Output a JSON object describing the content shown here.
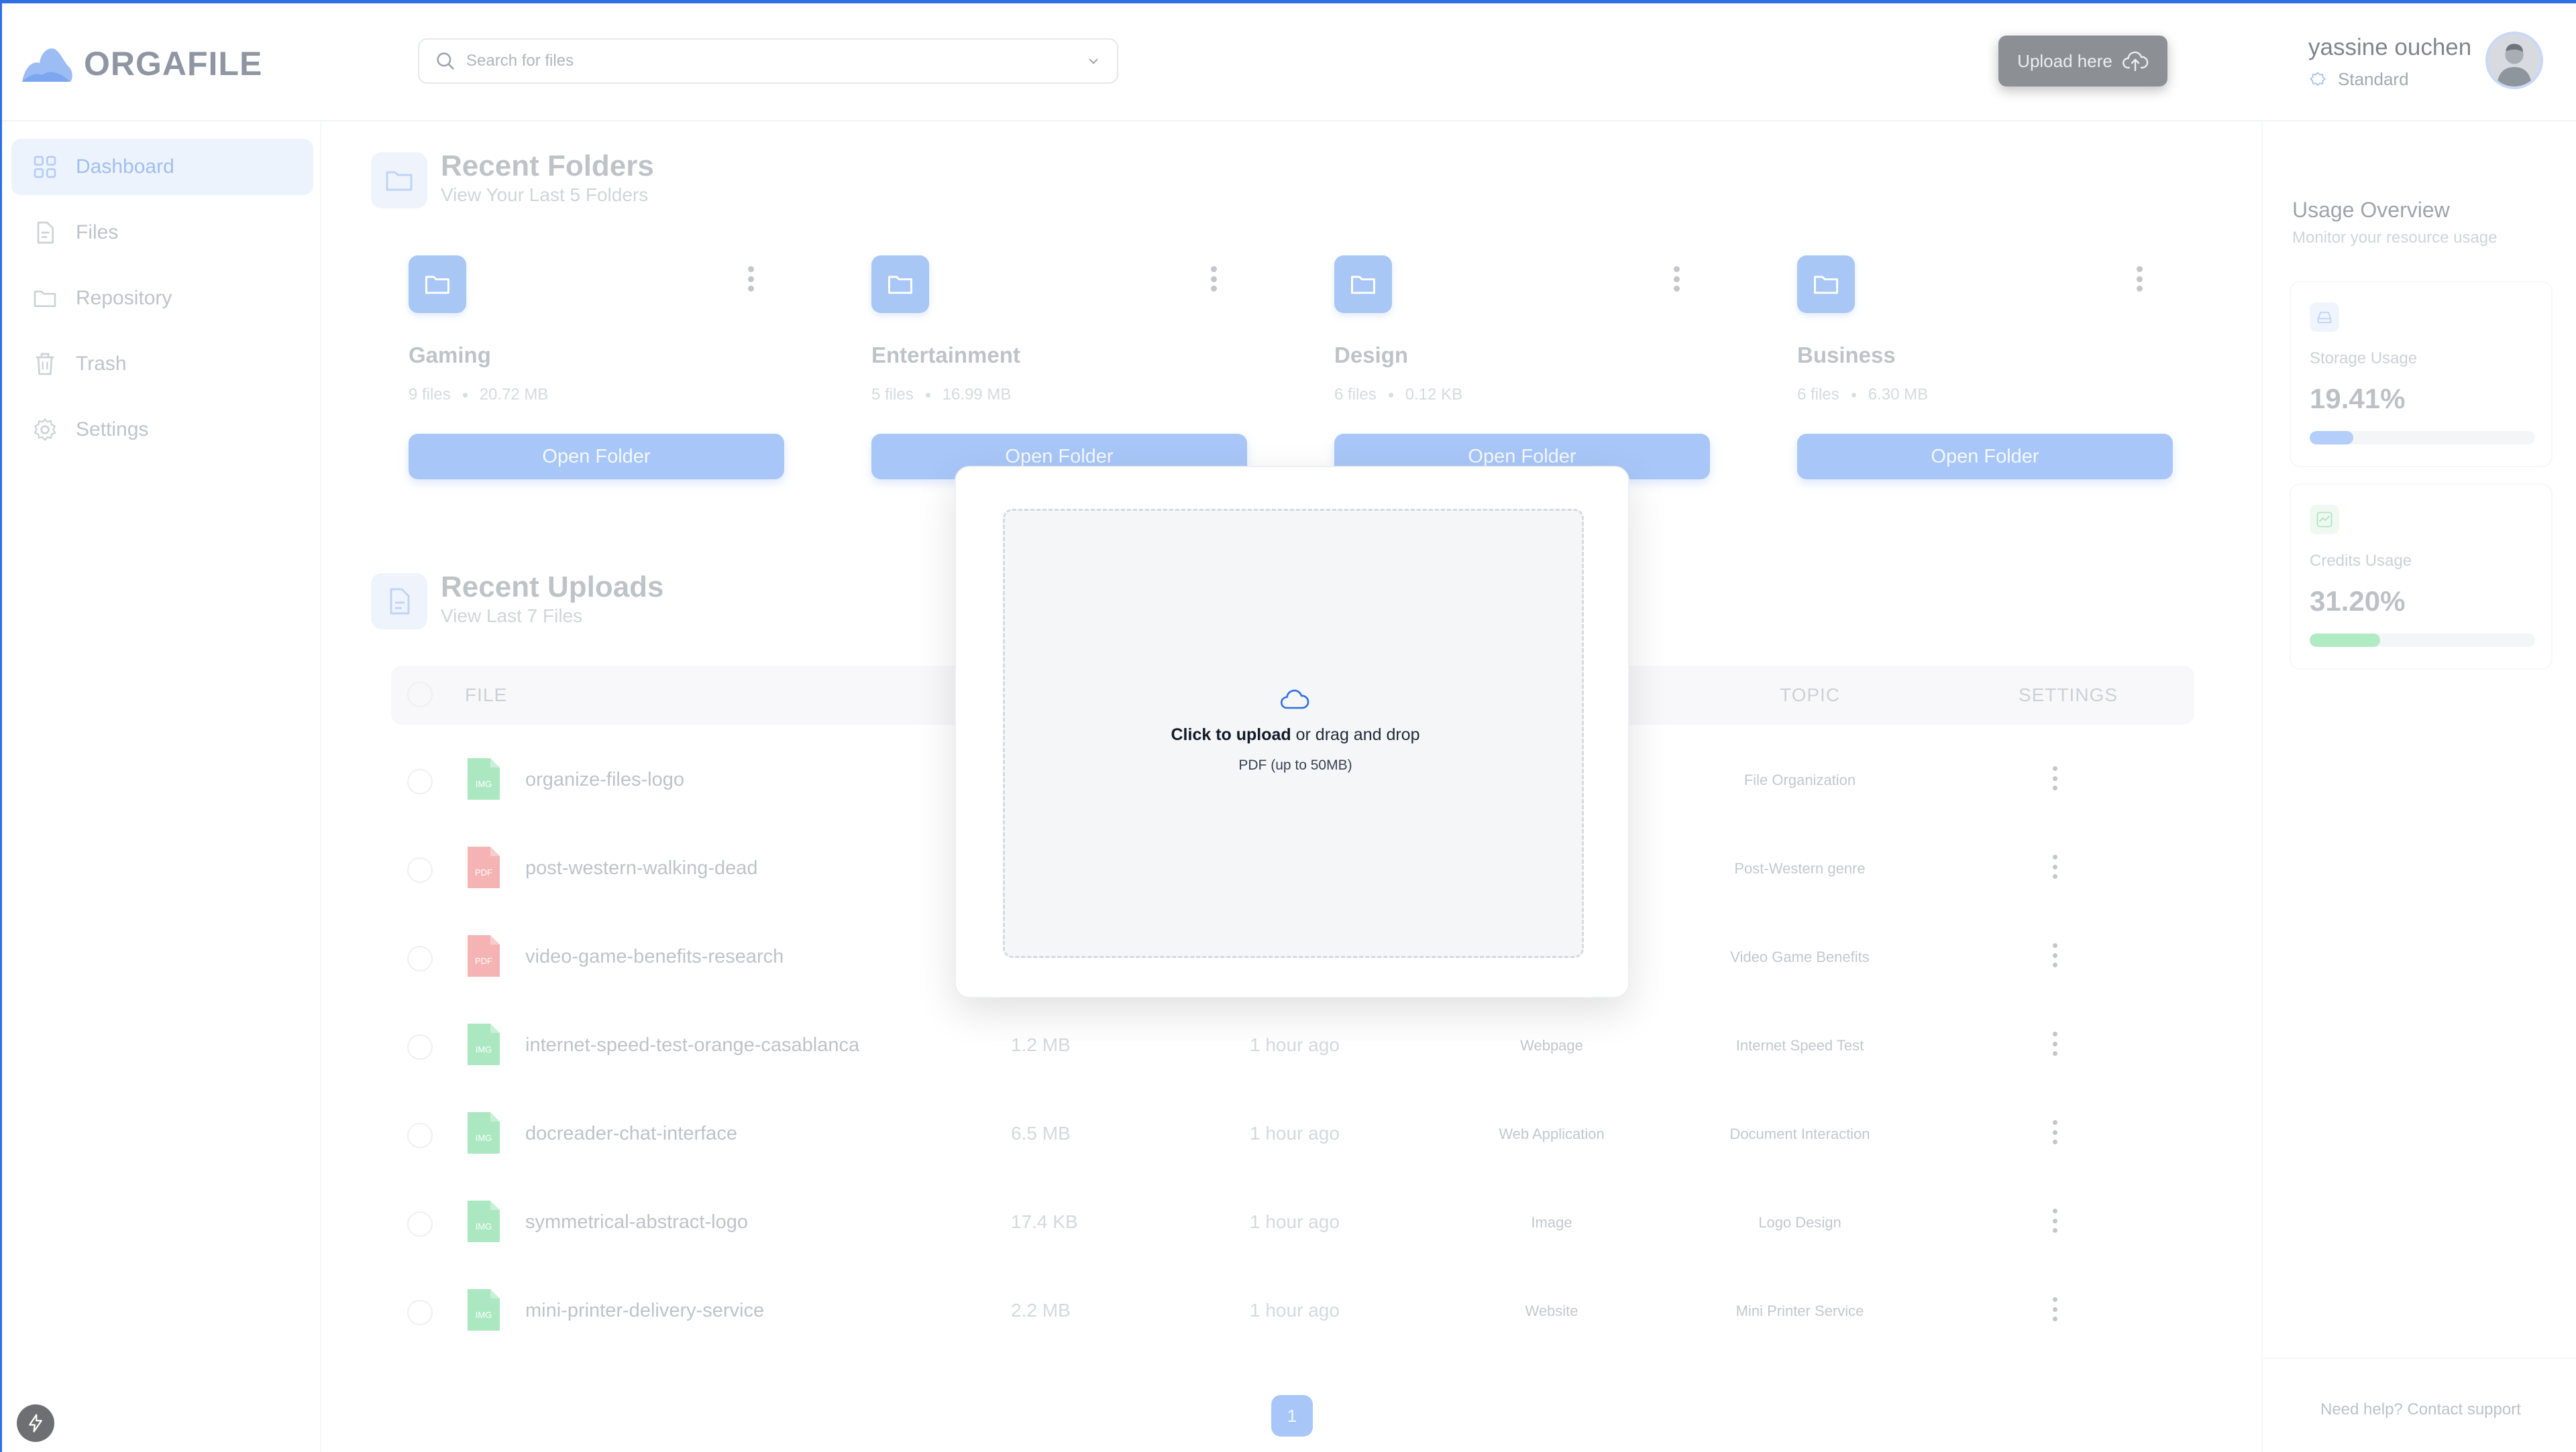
{
  "app": {
    "name": "ORGAFILE"
  },
  "header": {
    "search_placeholder": "Search for files",
    "upload_label": "Upload here",
    "user_name": "yassine ouchen",
    "user_plan": "Standard"
  },
  "sidebar": {
    "items": [
      {
        "label": "Dashboard",
        "icon": "grid-icon"
      },
      {
        "label": "Files",
        "icon": "file-icon"
      },
      {
        "label": "Repository",
        "icon": "folder-icon"
      },
      {
        "label": "Trash",
        "icon": "trash-icon"
      },
      {
        "label": "Settings",
        "icon": "gear-icon"
      }
    ]
  },
  "recent_folders": {
    "title": "Recent Folders",
    "subtitle": "View Your Last 5 Folders",
    "folders": [
      {
        "name": "Gaming",
        "count": "9 files",
        "size": "20.72 MB",
        "action": "Open Folder"
      },
      {
        "name": "Entertainment",
        "count": "5 files",
        "size": "16.99 MB",
        "action": "Open Folder"
      },
      {
        "name": "Design",
        "count": "6 files",
        "size": "0.12 KB",
        "action": "Open Folder"
      },
      {
        "name": "Business",
        "count": "6 files",
        "size": "6.30 MB",
        "action": "Open Folder"
      }
    ]
  },
  "recent_uploads": {
    "title": "Recent Uploads",
    "subtitle": "View Last 7 Files",
    "columns": {
      "file": "FILE",
      "topic": "TOPIC",
      "settings": "SETTINGS"
    },
    "rows": [
      {
        "name": "organize-files-logo",
        "ext": "IMG",
        "size": "",
        "time": "",
        "type": "",
        "topic": "File Organization"
      },
      {
        "name": "post-western-walking-dead",
        "ext": "PDF",
        "size": "",
        "time": "",
        "type": "",
        "topic": "Post-Western genre"
      },
      {
        "name": "video-game-benefits-research",
        "ext": "PDF",
        "size": "",
        "time": "",
        "type": "",
        "topic": "Video Game Benefits"
      },
      {
        "name": "internet-speed-test-orange-casablanca",
        "ext": "IMG",
        "size": "1.2 MB",
        "time": "1 hour ago",
        "type": "Webpage",
        "topic": "Internet Speed Test"
      },
      {
        "name": "docreader-chat-interface",
        "ext": "IMG",
        "size": "6.5 MB",
        "time": "1 hour ago",
        "type": "Web Application",
        "topic": "Document Interaction"
      },
      {
        "name": "symmetrical-abstract-logo",
        "ext": "IMG",
        "size": "17.4 KB",
        "time": "1 hour ago",
        "type": "Image",
        "topic": "Logo Design"
      },
      {
        "name": "mini-printer-delivery-service",
        "ext": "IMG",
        "size": "2.2 MB",
        "time": "1 hour ago",
        "type": "Website",
        "topic": "Mini Printer Service"
      }
    ],
    "page": "1"
  },
  "usage": {
    "title": "Usage Overview",
    "subtitle": "Monitor your resource usage",
    "storage": {
      "label": "Storage Usage",
      "value": "19.41%",
      "fraction": 0.1941,
      "color": "#8ab4f8"
    },
    "credits": {
      "label": "Credits Usage",
      "value": "31.20%",
      "fraction": 0.312,
      "color": "#86e0a4"
    },
    "help": "Need help? Contact support"
  },
  "upload_modal": {
    "click_text": "Click to upload",
    "rest_text": " or drag and drop",
    "hint": "PDF (up to 50MB)"
  },
  "colors": {
    "accent": "#2f6fe4",
    "primary_button": "#7aaaf5",
    "pdf_red": "#f28b8b",
    "img_green": "#7fdca0"
  }
}
